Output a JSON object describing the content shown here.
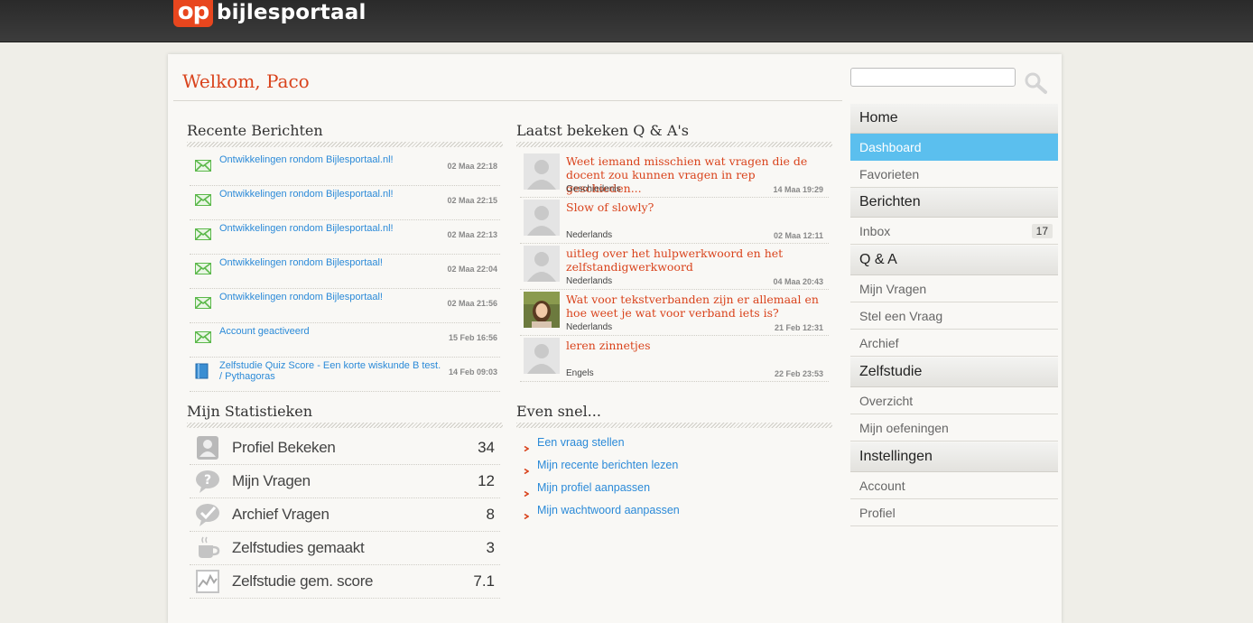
{
  "brand": {
    "mark": "op",
    "name": "bijlesportaal"
  },
  "header": {
    "welcome": "Welkom, Paco",
    "search_placeholder": ""
  },
  "recent_messages": {
    "title": "Recente Berichten",
    "items": [
      {
        "subject": "Ontwikkelingen rondom Bijlesportaal.nl!",
        "date": "02 Maa 22:18",
        "icon": "envelope-icon"
      },
      {
        "subject": "Ontwikkelingen rondom Bijlesportaal.nl!",
        "date": "02 Maa 22:15",
        "icon": "envelope-icon"
      },
      {
        "subject": "Ontwikkelingen rondom Bijlesportaal.nl!",
        "date": "02 Maa 22:13",
        "icon": "envelope-icon"
      },
      {
        "subject": "Ontwikkelingen rondom Bijlesportaal!",
        "date": "02 Maa 22:04",
        "icon": "envelope-icon"
      },
      {
        "subject": "Ontwikkelingen rondom Bijlesportaal!",
        "date": "02 Maa 21:56",
        "icon": "envelope-icon"
      },
      {
        "subject": "Account geactiveerd",
        "date": "15 Feb 16:56",
        "icon": "envelope-icon"
      },
      {
        "subject": "Zelfstudie Quiz Score - Een korte wiskunde B test. / Pythagoras",
        "date": "14 Feb 09:03",
        "icon": "book-icon"
      }
    ]
  },
  "stats": {
    "title": "Mijn Statistieken",
    "items": [
      {
        "label": "Profiel Bekeken",
        "value": "34",
        "icon": "profile-icon"
      },
      {
        "label": "Mijn Vragen",
        "value": "12",
        "icon": "question-icon"
      },
      {
        "label": "Archief Vragen",
        "value": "8",
        "icon": "check-bubble-icon"
      },
      {
        "label": "Zelfstudies gemaakt",
        "value": "3",
        "icon": "coffee-cup-icon"
      },
      {
        "label": "Zelfstudie gem. score",
        "value": "7.1",
        "icon": "chart-icon"
      }
    ]
  },
  "qa": {
    "title": "Laatst bekeken Q & A's",
    "items": [
      {
        "title": "Weet iemand misschien wat vragen die de docent zou kunnen vragen in rep geschieden...",
        "subject": "Geschiedenis",
        "date": "14 Maa 19:29",
        "avatar": "default"
      },
      {
        "title": "Slow of slowly?",
        "subject": "Nederlands",
        "date": "02 Maa 12:11",
        "avatar": "default"
      },
      {
        "title": "uitleg over het hulpwerkwoord en het zelfstandigwerkwoord",
        "subject": "Nederlands",
        "date": "04 Maa 20:43",
        "avatar": "default"
      },
      {
        "title": "Wat voor tekstverbanden zijn er allemaal en hoe weet je wat voor verband iets is?",
        "subject": "Nederlands",
        "date": "21 Feb 12:31",
        "avatar": "photo"
      },
      {
        "title": "leren zinnetjes",
        "subject": "Engels",
        "date": "22 Feb 23:53",
        "avatar": "default"
      }
    ]
  },
  "quick": {
    "title": "Even snel...",
    "links": [
      "Een vraag stellen",
      "Mijn recente berichten lezen",
      "Mijn profiel aanpassen",
      "Mijn wachtwoord aanpassen"
    ]
  },
  "sidebar": {
    "home": "Home",
    "dashboard": "Dashboard",
    "favorieten": "Favorieten",
    "berichten": "Berichten",
    "inbox": "Inbox",
    "inbox_count": "17",
    "qa": "Q & A",
    "mijn_vragen": "Mijn Vragen",
    "stel_vraag": "Stel een Vraag",
    "archief": "Archief",
    "zelfstudie": "Zelfstudie",
    "overzicht": "Overzicht",
    "oefeningen": "Mijn oefeningen",
    "instellingen": "Instellingen",
    "account": "Account",
    "profiel": "Profiel"
  },
  "colors": {
    "accent": "#d9431c",
    "link": "#2b8ad8",
    "active": "#5bbfee",
    "envelope": "#5bb84a"
  }
}
